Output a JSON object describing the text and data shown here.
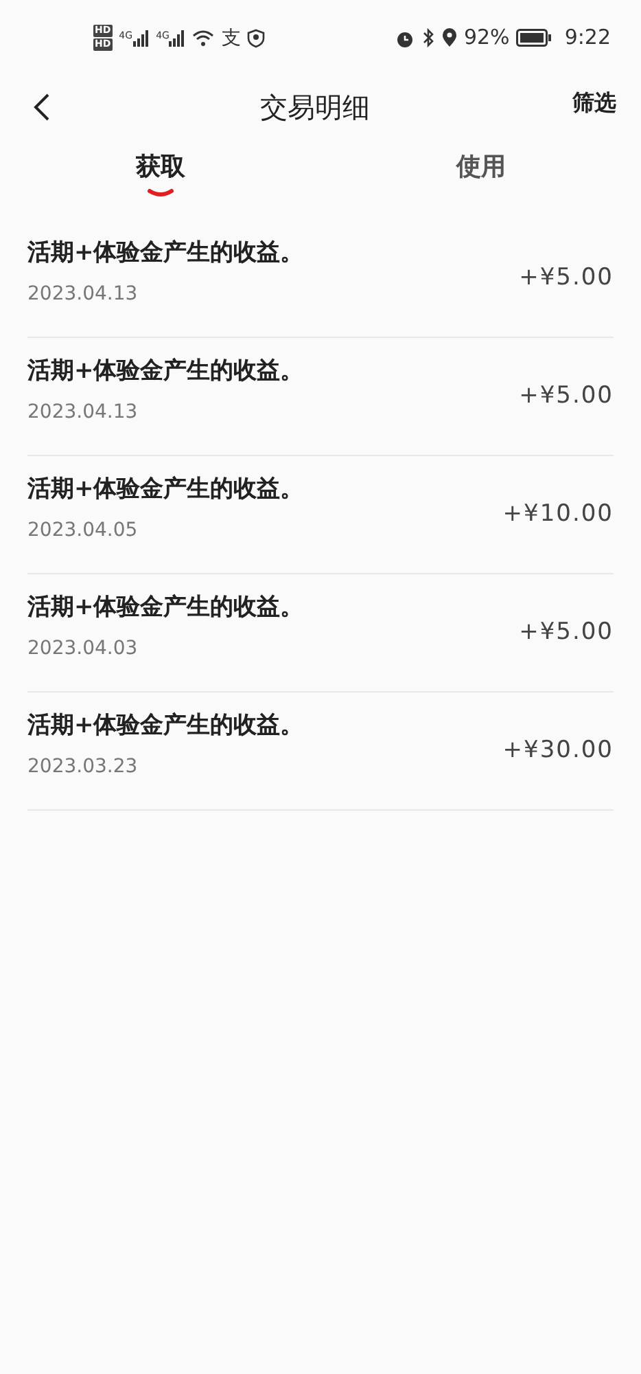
{
  "status_bar": {
    "sims": [
      {
        "label": "HD",
        "network": "4G"
      },
      {
        "label": "HD",
        "network": "4G"
      }
    ],
    "app_badge": "支",
    "battery": "92%",
    "time": "9:22"
  },
  "header": {
    "title": "交易明细",
    "action": "筛选"
  },
  "tabs": [
    {
      "label": "获取",
      "selected": true
    },
    {
      "label": "使用",
      "selected": false
    }
  ],
  "transactions": [
    {
      "description": "活期+体验金产生的收益。",
      "date": "2023.04.13",
      "amount": "+¥5.00"
    },
    {
      "description": "活期+体验金产生的收益。",
      "date": "2023.04.13",
      "amount": "+¥5.00"
    },
    {
      "description": "活期+体验金产生的收益。",
      "date": "2023.04.05",
      "amount": "+¥10.00"
    },
    {
      "description": "活期+体验金产生的收益。",
      "date": "2023.04.03",
      "amount": "+¥5.00"
    },
    {
      "description": "活期+体验金产生的收益。",
      "date": "2023.03.23",
      "amount": "+¥30.00"
    }
  ]
}
